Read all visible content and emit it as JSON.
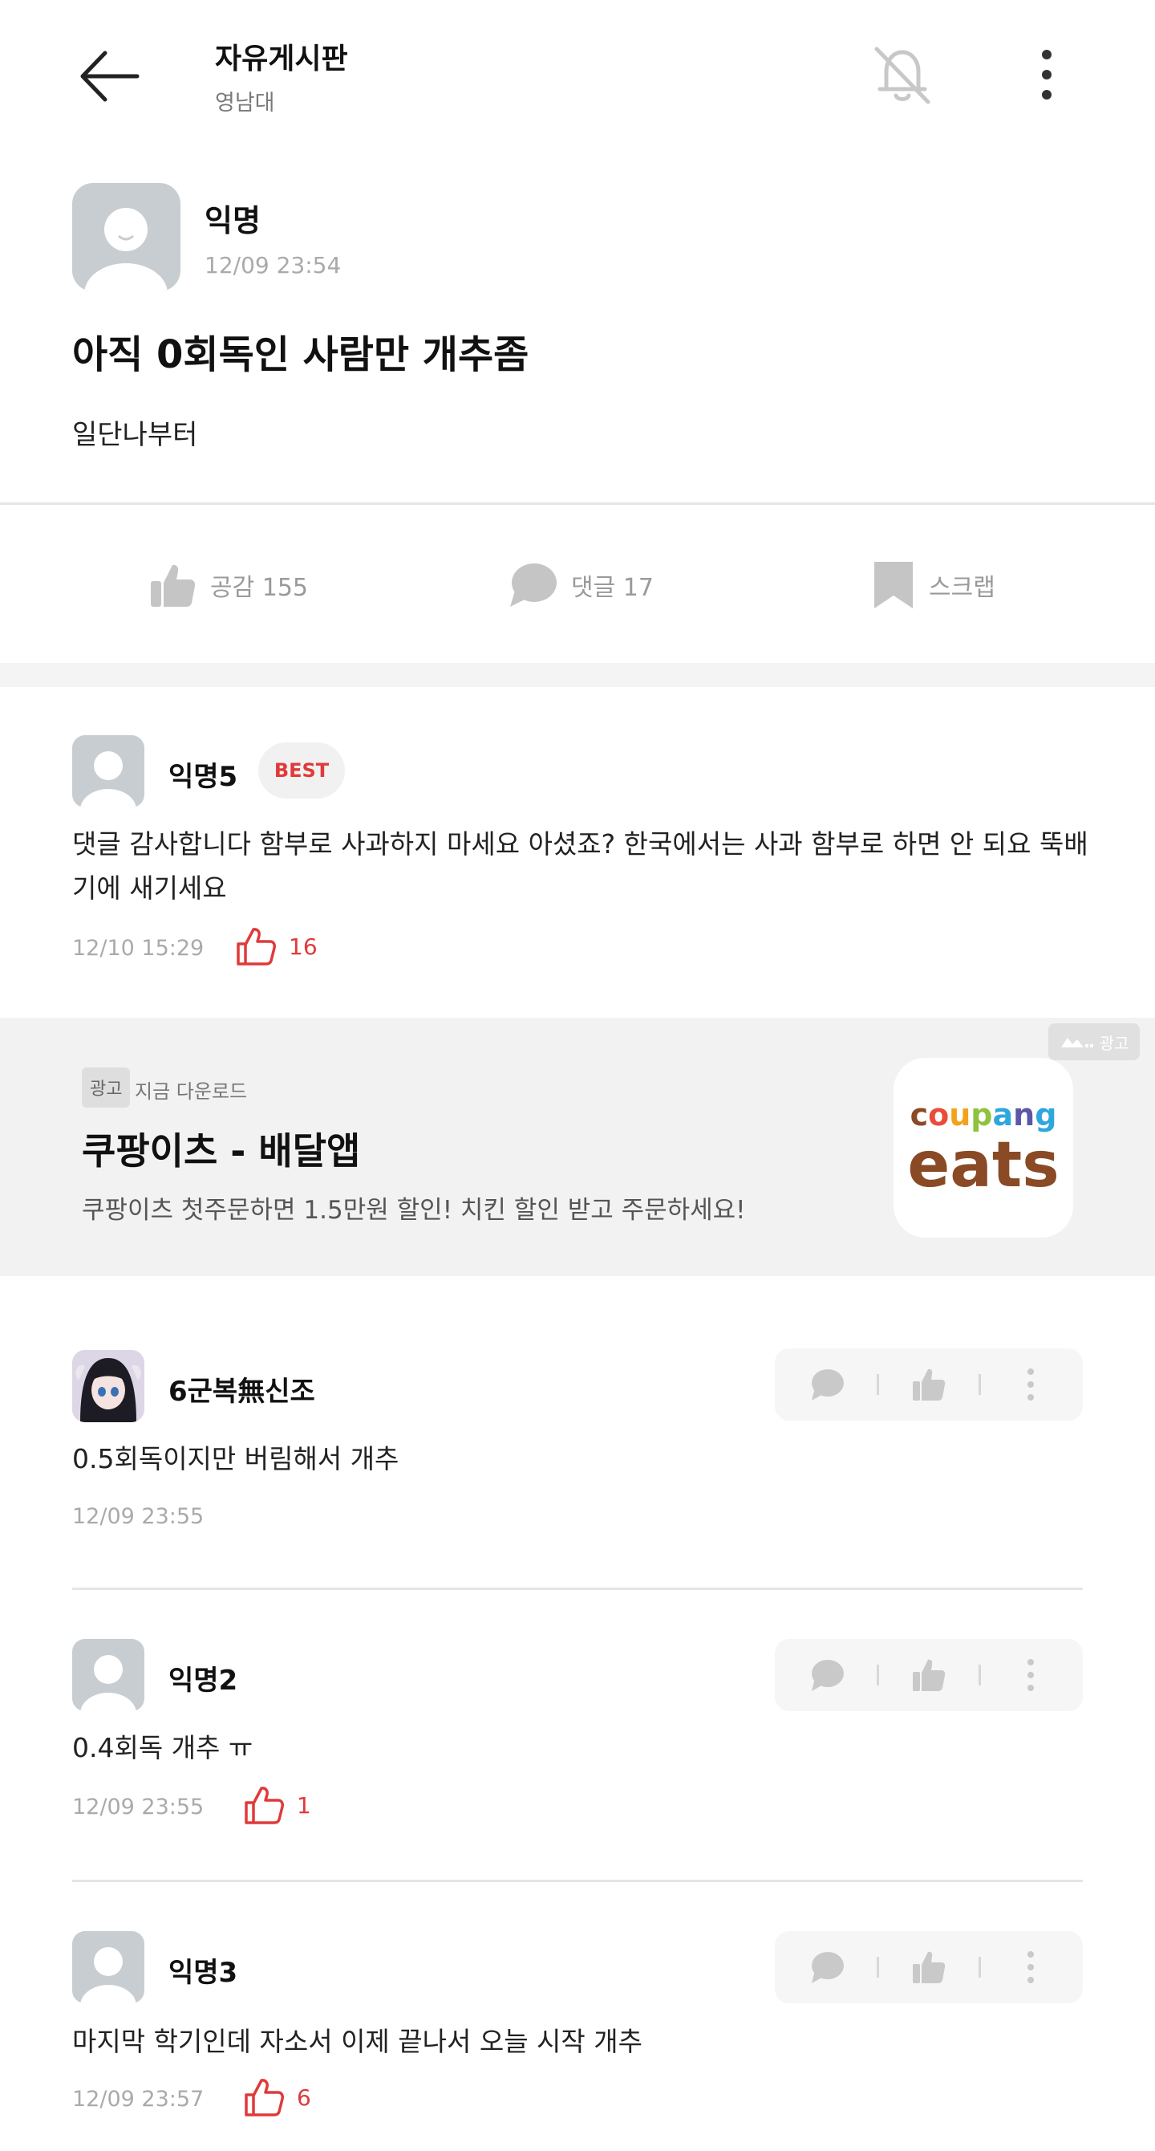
{
  "header": {
    "board_title": "자유게시판",
    "board_subtitle": "영남대",
    "icons": [
      "back-arrow-icon",
      "bell-off-icon",
      "more-vertical-icon"
    ]
  },
  "post": {
    "author": "익명",
    "time": "12/09 23:54",
    "title": "아직 0회독인 사람만 개추좀",
    "body": "일단나부터"
  },
  "actions": {
    "like_label": "공감 155",
    "comment_label": "댓글 17",
    "scrap_label": "스크랩"
  },
  "best_comment": {
    "author": "익명5",
    "badge": "BEST",
    "text": "댓글 감사합니다 함부로 사과하지 마세요 아셨죠? 한국에서는 사과 함부로 하면 안 되요 뚝배기에 새기세요",
    "time": "12/10 15:29",
    "likes": "16"
  },
  "ad": {
    "corner_label": "광고",
    "tag": "광고",
    "cta": "지금 다운로드",
    "title": "쿠팡이츠 - 배달앱",
    "description": "쿠팡이츠 첫주문하면 1.5만원 할인! 치킨 할인 받고 주문하세요!",
    "logo_top": "coupang",
    "logo_bottom": "eats",
    "logo_colors": [
      "#e94d3a",
      "#f2a31b",
      "#8fc23f",
      "#2fa6de",
      "#5b57a6"
    ]
  },
  "comments": [
    {
      "author": "6군복無신조",
      "text": "0.5회독이지만 버림해서 개추",
      "time": "12/09 23:55",
      "likes": ""
    },
    {
      "author": "익명2",
      "text": "0.4회독 개추 ㅠ",
      "time": "12/09 23:55",
      "likes": "1"
    },
    {
      "author": "익명3",
      "text": "마지막 학기인데 자소서 이제 끝나서 오늘 시작 개추",
      "time": "12/09 23:57",
      "likes": "6"
    }
  ]
}
